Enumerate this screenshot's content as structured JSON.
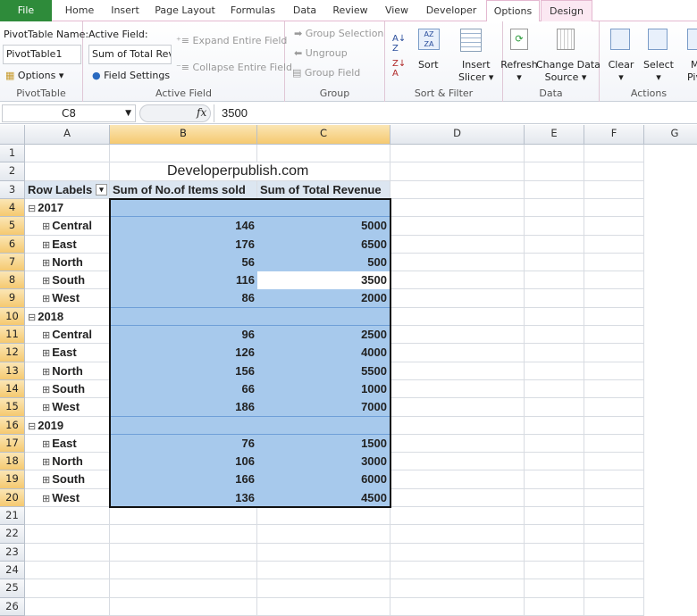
{
  "tabs": [
    "File",
    "Home",
    "Insert",
    "Page Layout",
    "Formulas",
    "Data",
    "Review",
    "View",
    "Developer",
    "Options",
    "Design"
  ],
  "active_tab": "Options",
  "ribbon": {
    "pivot_name_label": "PivotTable Name:",
    "pivot_name_value": "PivotTable1",
    "options_label": "Options",
    "group_pivot": "PivotTable",
    "active_field_label": "Active Field:",
    "active_field_value": "Sum of Total Reve",
    "field_settings": "Field Settings",
    "expand": "Expand Entire Field",
    "collapse": "Collapse Entire Field",
    "group_active": "Active Field",
    "group_selection": "Group Selection",
    "ungroup": "Ungroup",
    "group_field": "Group Field",
    "group_group": "Group",
    "sort": "Sort",
    "insert_slicer_1": "Insert",
    "insert_slicer_2": "Slicer",
    "group_sort": "Sort & Filter",
    "refresh": "Refresh",
    "change_data_1": "Change Data",
    "change_data_2": "Source",
    "group_data": "Data",
    "clear": "Clear",
    "select": "Select",
    "move_1": "M",
    "move_2": "Pivo",
    "group_actions": "Actions"
  },
  "formula_bar": {
    "name_box": "C8",
    "fx": "fx",
    "value": "3500"
  },
  "columns": [
    "A",
    "B",
    "C",
    "D",
    "E",
    "F",
    "G"
  ],
  "rows": [
    {
      "n": "1",
      "a": "",
      "b": "",
      "c": ""
    },
    {
      "n": "2",
      "a": "",
      "b": "Developerpublish.com",
      "c": ""
    },
    {
      "n": "3",
      "a": "Row Labels",
      "b": "Sum of No.of Items sold",
      "c": "Sum of Total Revenue",
      "header": true
    },
    {
      "n": "4",
      "a": "2017",
      "b": "",
      "c": "",
      "year": true
    },
    {
      "n": "5",
      "a": "Central",
      "b": "146",
      "c": "5000"
    },
    {
      "n": "6",
      "a": "East",
      "b": "176",
      "c": "6500"
    },
    {
      "n": "7",
      "a": "North",
      "b": "56",
      "c": "500"
    },
    {
      "n": "8",
      "a": "South",
      "b": "116",
      "c": "3500"
    },
    {
      "n": "9",
      "a": "West",
      "b": "86",
      "c": "2000"
    },
    {
      "n": "10",
      "a": "2018",
      "b": "",
      "c": "",
      "year": true
    },
    {
      "n": "11",
      "a": "Central",
      "b": "96",
      "c": "2500"
    },
    {
      "n": "12",
      "a": "East",
      "b": "126",
      "c": "4000"
    },
    {
      "n": "13",
      "a": "North",
      "b": "156",
      "c": "5500"
    },
    {
      "n": "14",
      "a": "South",
      "b": "66",
      "c": "1000"
    },
    {
      "n": "15",
      "a": "West",
      "b": "186",
      "c": "7000"
    },
    {
      "n": "16",
      "a": "2019",
      "b": "",
      "c": "",
      "year": true
    },
    {
      "n": "17",
      "a": "East",
      "b": "76",
      "c": "1500"
    },
    {
      "n": "18",
      "a": "North",
      "b": "106",
      "c": "3000"
    },
    {
      "n": "19",
      "a": "South",
      "b": "166",
      "c": "6000"
    },
    {
      "n": "20",
      "a": "West",
      "b": "136",
      "c": "4500"
    },
    {
      "n": "21",
      "a": "",
      "b": "",
      "c": ""
    },
    {
      "n": "22",
      "a": "",
      "b": "",
      "c": ""
    },
    {
      "n": "23",
      "a": "",
      "b": "",
      "c": ""
    },
    {
      "n": "24",
      "a": "",
      "b": "",
      "c": ""
    },
    {
      "n": "25",
      "a": "",
      "b": "",
      "c": ""
    },
    {
      "n": "26",
      "a": "",
      "b": "",
      "c": ""
    }
  ],
  "colors": {
    "selection": "#a7c9ec",
    "header_highlight": "#f5c970",
    "pivot_header": "#dce6f1",
    "file_tab": "#2e8b3a"
  }
}
